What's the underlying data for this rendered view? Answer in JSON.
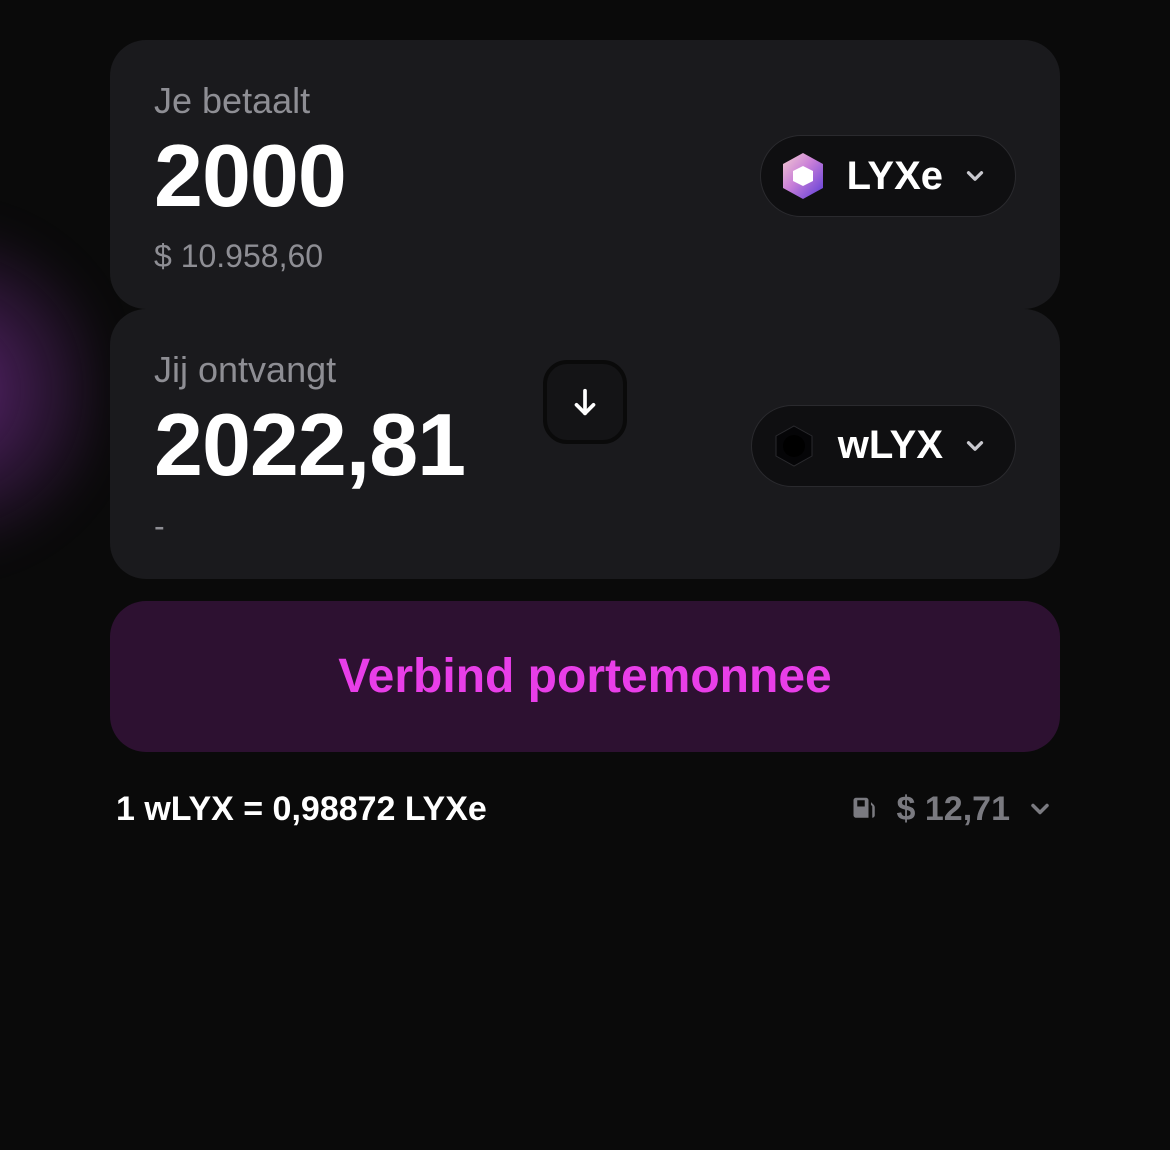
{
  "pay": {
    "label": "Je betaalt",
    "amount": "2000",
    "fiat": "$ 10.958,60",
    "token": {
      "symbol": "LYXe",
      "icon": "lyxe"
    }
  },
  "receive": {
    "label": "Jij ontvangt",
    "amount": "2022,81",
    "fiat": "-",
    "token": {
      "symbol": "wLYX",
      "icon": "wlyx"
    }
  },
  "cta": {
    "label": "Verbind portemonnee"
  },
  "footer": {
    "rate": "1 wLYX = 0,98872 LYXe",
    "gas": "$ 12,71"
  },
  "colors": {
    "accent": "#e83ee8"
  }
}
